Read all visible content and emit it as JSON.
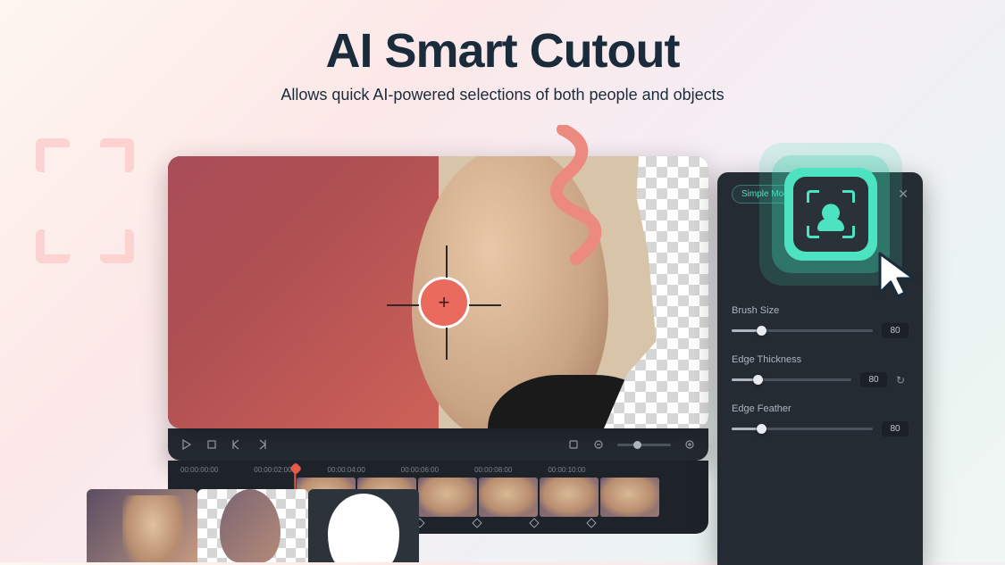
{
  "header": {
    "title": "AI Smart Cutout",
    "subtitle": "Allows quick AI-powered selections of both people and objects"
  },
  "panel": {
    "mode_chip": "Simple Mode",
    "sliders": {
      "brush": {
        "label": "Brush Size",
        "value": "80",
        "percent": 18
      },
      "edge_thickness": {
        "label": "Edge Thickness",
        "value": "80",
        "percent": 18
      },
      "edge_feather": {
        "label": "Edge Feather",
        "value": "80",
        "percent": 18
      }
    }
  },
  "timeline": {
    "marks": [
      "00:00:00:00",
      "00:00:02:00",
      "00:00:04:00",
      "00:00:06:00",
      "00:00:08:00",
      "00:00:10:00"
    ]
  },
  "icons": {
    "brush_plus": "+",
    "close": "✕",
    "reset": "↻"
  }
}
